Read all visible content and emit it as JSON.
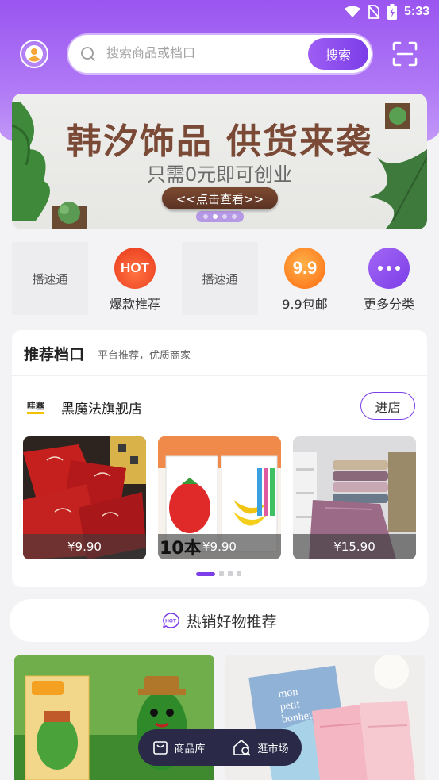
{
  "status_bar": {
    "time": "5:33"
  },
  "search": {
    "placeholder": "搜索商品或档口",
    "button_label": "搜索"
  },
  "banner": {
    "title": "韩汐饰品 供货来袭",
    "subtitle": "只需0元即可创业",
    "cta": "<<点击查看>>",
    "slide_count": 4,
    "active_slide": 2
  },
  "quick_menu": [
    {
      "placeholder": "播速通"
    },
    {
      "label": "爆款推荐",
      "badge": "HOT",
      "icon": "hot-icon",
      "color": "#f5522e"
    },
    {
      "placeholder": "播速通"
    },
    {
      "label": "9.9包邮",
      "badge": "9.9",
      "icon": "nine-nine-icon",
      "color": "#ff7a1f"
    },
    {
      "label": "更多分类",
      "icon": "more-dots-icon",
      "color": "#8a45ee"
    }
  ],
  "recommend": {
    "title": "推荐档口",
    "subtitle": "平台推荐，优质商家",
    "shop": {
      "logo_text": "哇塞",
      "name": "黑魔法旗舰店",
      "enter_label": "进店"
    },
    "products": [
      {
        "price": "¥9.90"
      },
      {
        "price": "¥9.90",
        "overlay_text": "10本"
      },
      {
        "price": "¥15.90"
      }
    ],
    "page_count": 4,
    "active_page": 1
  },
  "hot_section": {
    "label": "热销好物推荐",
    "badge": "HOT"
  },
  "bottom_nav": [
    {
      "label": "商品库",
      "icon": "bag-icon"
    },
    {
      "label": "逛市场",
      "icon": "house-search-icon"
    }
  ],
  "colors": {
    "brand_purple": "#7b3ee8",
    "hero_top": "#9a55f0"
  }
}
